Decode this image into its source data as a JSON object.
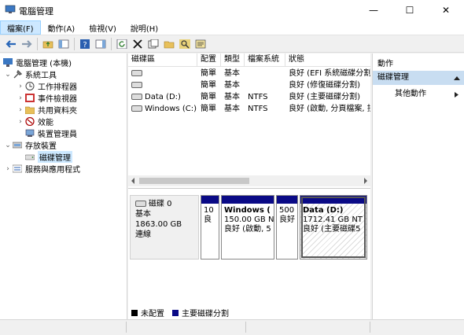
{
  "window": {
    "title": "電腦管理",
    "minimize": "—",
    "maximize": "☐",
    "close": "✕"
  },
  "menu": [
    {
      "label": "檔案(F)"
    },
    {
      "label": "動作(A)"
    },
    {
      "label": "檢視(V)"
    },
    {
      "label": "說明(H)"
    }
  ],
  "tree": [
    {
      "label": "電腦管理 (本機)",
      "icon": "computer-management-icon"
    },
    {
      "label": "系統工具",
      "icon": "system-tools-icon",
      "arrow": "⌄"
    },
    {
      "label": "工作排程器",
      "icon": "task-scheduler-icon",
      "arrow": "›"
    },
    {
      "label": "事件檢視器",
      "icon": "event-viewer-icon",
      "arrow": "›"
    },
    {
      "label": "共用資料夾",
      "icon": "shared-folders-icon",
      "arrow": "›"
    },
    {
      "label": "效能",
      "icon": "performance-icon",
      "arrow": "›"
    },
    {
      "label": "裝置管理員",
      "icon": "device-manager-icon"
    },
    {
      "label": "存放裝置",
      "icon": "storage-icon",
      "arrow": "⌄"
    },
    {
      "label": "磁碟管理",
      "icon": "disk-management-icon"
    },
    {
      "label": "服務與應用程式",
      "icon": "services-icon",
      "arrow": "›"
    }
  ],
  "volumes": {
    "headers": [
      "磁碟區",
      "配置",
      "類型",
      "檔案系統",
      "狀態"
    ],
    "rows": [
      [
        "",
        "簡單",
        "基本",
        "",
        "良好 (EFI 系統磁碟分割)"
      ],
      [
        "",
        "簡單",
        "基本",
        "",
        "良好 (修復磁碟分割)"
      ],
      [
        "Data (D:)",
        "簡單",
        "基本",
        "NTFS",
        "良好 (主要磁碟分割)"
      ],
      [
        "Windows (C:)",
        "簡單",
        "基本",
        "NTFS",
        "良好 (啟動, 分頁檔案, 損"
      ]
    ]
  },
  "disk": {
    "name": "磁碟 0",
    "type": "基本",
    "size": "1863.00 GB",
    "status": "連線",
    "partitions": [
      {
        "line1": "",
        "line2": "10",
        "line3": "良"
      },
      {
        "line1": "Windows (",
        "line2": "150.00 GB N",
        "line3": "良好 (啟動, 5"
      },
      {
        "line1": "",
        "line2": "500 I",
        "line3": "良好"
      },
      {
        "line1": "Data (D:)",
        "line2": "1712.41 GB NT",
        "line3": "良好 (主要磁碟5"
      }
    ]
  },
  "legend": [
    {
      "label": "未配置",
      "color": "#000000"
    },
    {
      "label": "主要磁碟分割",
      "color": "#0a0a86"
    }
  ],
  "actions": {
    "header": "動作",
    "selected": "磁碟管理",
    "item": "其他動作"
  },
  "colors": {
    "accent": "#0a0a86",
    "selection": "#cce8ff"
  }
}
